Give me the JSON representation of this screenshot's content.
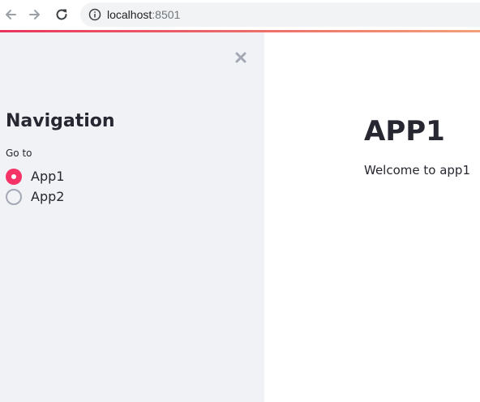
{
  "browser": {
    "url_host": "localhost",
    "url_port": ":8501",
    "icons": [
      "back-arrow-icon",
      "forward-arrow-icon",
      "reload-icon",
      "info-icon"
    ]
  },
  "theme": {
    "primary": "#f63366",
    "sidebar_bg": "#f0f2f6",
    "text": "#262730"
  },
  "sidebar": {
    "close_icon": "close-icon",
    "title": "Navigation",
    "radio_label": "Go to",
    "options": [
      {
        "label": "App1",
        "selected": true
      },
      {
        "label": "App2",
        "selected": false
      }
    ]
  },
  "main": {
    "title": "APP1",
    "text": "Welcome to app1"
  }
}
